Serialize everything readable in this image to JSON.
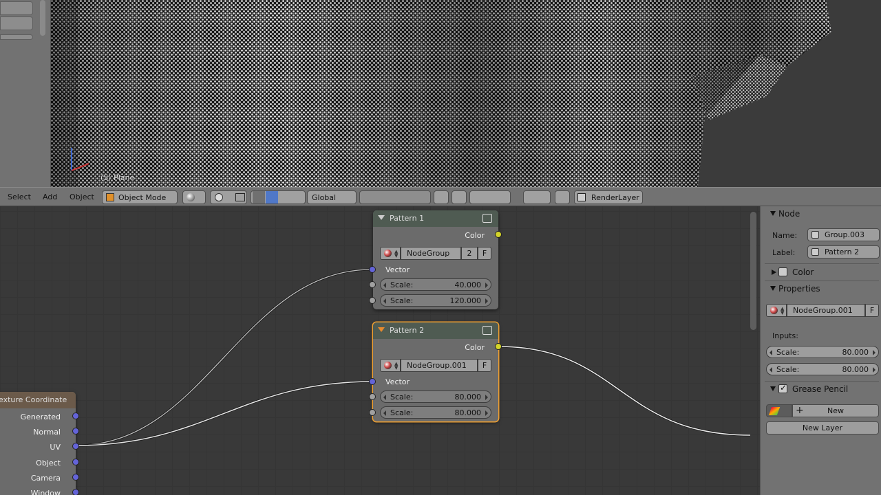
{
  "viewport": {
    "object_label": "(5) Plane"
  },
  "header": {
    "menu": [
      "Select",
      "Add",
      "Object"
    ],
    "mode": "Object Mode",
    "orientation": "Global",
    "render_layer": "RenderLayer"
  },
  "nodes": {
    "pattern1": {
      "title": "Pattern 1",
      "output": "Color",
      "group": "NodeGroup",
      "users": "2",
      "fake": "F",
      "vector": "Vector",
      "inputs": [
        {
          "label": "Scale:",
          "value": "40.000"
        },
        {
          "label": "Scale:",
          "value": "120.000"
        }
      ]
    },
    "pattern2": {
      "title": "Pattern 2",
      "output": "Color",
      "group": "NodeGroup.001",
      "fake": "F",
      "vector": "Vector",
      "inputs": [
        {
          "label": "Scale:",
          "value": "80.000"
        },
        {
          "label": "Scale:",
          "value": "80.000"
        }
      ]
    },
    "texcoord": {
      "title": "exture Coordinate",
      "outputs": [
        "Generated",
        "Normal",
        "UV",
        "Object",
        "Camera",
        "Window"
      ]
    }
  },
  "props": {
    "node_panel": {
      "title": "Node",
      "name_label": "Name:",
      "name_value": "Group.003",
      "label_label": "Label:",
      "label_value": "Pattern 2"
    },
    "color_panel": {
      "title": "Color"
    },
    "properties_panel": {
      "title": "Properties",
      "group": "NodeGroup.001",
      "fake": "F",
      "inputs_label": "Inputs:",
      "inputs": [
        {
          "label": "Scale:",
          "value": "80.000"
        },
        {
          "label": "Scale:",
          "value": "80.000"
        }
      ]
    },
    "grease_panel": {
      "title": "Grease Pencil",
      "new_label": "New",
      "new_layer_label": "New Layer"
    }
  },
  "colors": {
    "accent_active": "#f0a030",
    "socket_color": "#d4d42a",
    "socket_vector": "#6464d8"
  }
}
